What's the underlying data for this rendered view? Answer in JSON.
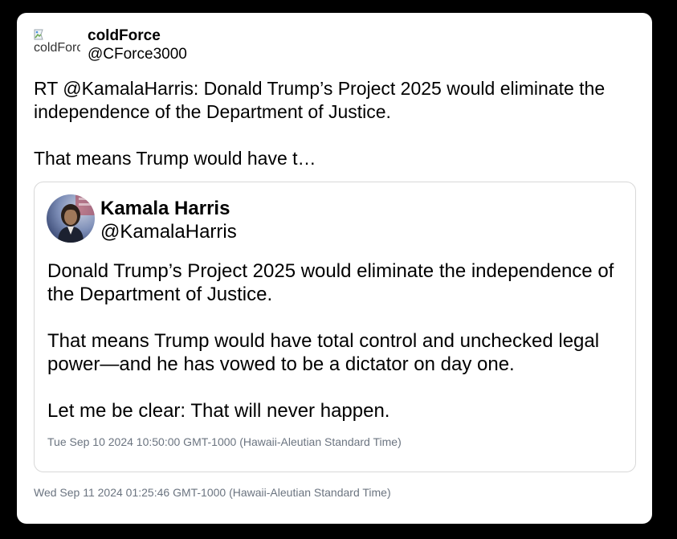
{
  "post": {
    "author": {
      "avatar_alt": "coldForce",
      "name": "coldForce",
      "handle": "@CForce3000"
    },
    "text": {
      "line1": "RT @KamalaHarris: Donald Trump’s Project 2025 would eliminate the independence of the Department of Justice.",
      "line2": "That means Trump would have t…"
    },
    "timestamp": "Wed Sep 11 2024 01:25:46 GMT-1000 (Hawaii-Aleutian Standard Time)"
  },
  "quoted_post": {
    "author": {
      "name": "Kamala Harris",
      "handle": "@KamalaHarris"
    },
    "text": {
      "paragraph1": "Donald Trump’s Project 2025 would eliminate the independence of the Department of Justice.",
      "paragraph2": "That means Trump would have total control and unchecked legal power—and he has vowed to be a dictator on day one.",
      "paragraph3": "Let me be clear: That will never happen."
    },
    "timestamp": "Tue Sep 10 2024 10:50:00 GMT-1000 (Hawaii-Aleutian Standard Time)"
  },
  "colors": {
    "page_background": "#000000",
    "card_background": "#ffffff",
    "timestamp_text": "#6b7480",
    "quote_border": "#d8d8d8"
  },
  "icons": {
    "author_avatar": "broken-image-icon",
    "quoted_avatar": "profile-photo"
  }
}
